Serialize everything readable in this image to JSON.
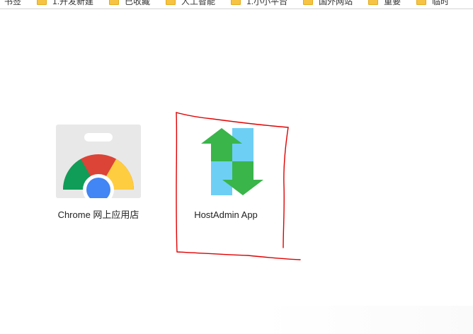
{
  "bookmarks_bar": {
    "items": [
      {
        "label": "书签",
        "icon": "folder-icon"
      },
      {
        "label": "1.开发新建",
        "icon": "folder-icon"
      },
      {
        "label": "已收藏",
        "icon": "folder-icon"
      },
      {
        "label": "人工智能",
        "icon": "folder-icon"
      },
      {
        "label": "1.小小平台",
        "icon": "folder-icon"
      },
      {
        "label": "国外网站",
        "icon": "folder-icon"
      },
      {
        "label": "重要",
        "icon": "folder-icon"
      },
      {
        "label": "临时",
        "icon": "folder-icon"
      }
    ]
  },
  "apps": [
    {
      "label": "Chrome 网上应用店",
      "icon": "chrome-web-store-icon"
    },
    {
      "label": "HostAdmin App",
      "icon": "hostadmin-icon"
    }
  ],
  "annotation": {
    "color": "#e00000",
    "highlight": "HostAdmin App"
  }
}
